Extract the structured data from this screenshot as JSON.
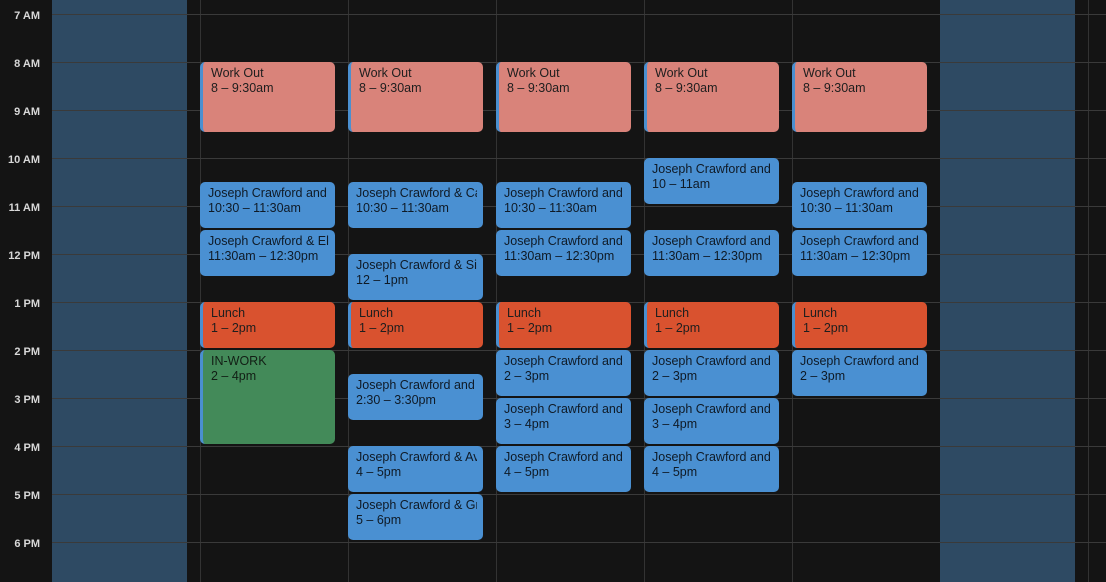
{
  "time_labels": [
    "7 AM",
    "8 AM",
    "9 AM",
    "10 AM",
    "11 AM",
    "12 PM",
    "1 PM",
    "2 PM",
    "3 PM",
    "4 PM",
    "5 PM",
    "6 PM"
  ],
  "colors": {
    "background": "#141414",
    "weekend": "#2e4a63",
    "workout": "#d9837a",
    "meeting": "#4a90d2",
    "lunch": "#d9522f",
    "inwork": "#438a59"
  },
  "events": {
    "mon": [
      {
        "title": "Work Out",
        "time": "8 – 9:30am",
        "kind": "workout"
      },
      {
        "title": "Joseph Crawford and J",
        "time": "10:30 – 11:30am",
        "kind": "meeting"
      },
      {
        "title": "Joseph Crawford & Ele",
        "time": "11:30am – 12:30pm",
        "kind": "meeting"
      },
      {
        "title": "Lunch",
        "time": "1 – 2pm",
        "kind": "lunch"
      },
      {
        "title": "IN-WORK",
        "time": "2 – 4pm",
        "kind": "inwork"
      }
    ],
    "tue": [
      {
        "title": "Work Out",
        "time": "8 – 9:30am",
        "kind": "workout"
      },
      {
        "title": "Joseph Crawford & Ca",
        "time": "10:30 – 11:30am",
        "kind": "meeting"
      },
      {
        "title": "Joseph Crawford & Sie",
        "time": "12 – 1pm",
        "kind": "meeting"
      },
      {
        "title": "Lunch",
        "time": "1 – 2pm",
        "kind": "lunch"
      },
      {
        "title": "Joseph Crawford and",
        "time": "2:30 – 3:30pm",
        "kind": "meeting"
      },
      {
        "title": "Joseph Crawford & Av",
        "time": "4 – 5pm",
        "kind": "meeting"
      },
      {
        "title": "Joseph Crawford & Gr",
        "time": "5 – 6pm",
        "kind": "meeting"
      }
    ],
    "wed": [
      {
        "title": "Work Out",
        "time": "8 – 9:30am",
        "kind": "workout"
      },
      {
        "title": "Joseph Crawford and",
        "time": "10:30 – 11:30am",
        "kind": "meeting"
      },
      {
        "title": "Joseph Crawford and",
        "time": "11:30am – 12:30pm",
        "kind": "meeting"
      },
      {
        "title": "Lunch",
        "time": "1 – 2pm",
        "kind": "lunch"
      },
      {
        "title": "Joseph Crawford and",
        "time": "2 – 3pm",
        "kind": "meeting"
      },
      {
        "title": "Joseph Crawford and",
        "time": "3 – 4pm",
        "kind": "meeting"
      },
      {
        "title": "Joseph Crawford and",
        "time": "4 – 5pm",
        "kind": "meeting"
      }
    ],
    "thu": [
      {
        "title": "Work Out",
        "time": "8 – 9:30am",
        "kind": "workout"
      },
      {
        "title": "Joseph Crawford and",
        "time": "10 – 11am",
        "kind": "meeting"
      },
      {
        "title": "Joseph Crawford and",
        "time": "11:30am – 12:30pm",
        "kind": "meeting"
      },
      {
        "title": "Lunch",
        "time": "1 – 2pm",
        "kind": "lunch"
      },
      {
        "title": "Joseph Crawford and",
        "time": "2 – 3pm",
        "kind": "meeting"
      },
      {
        "title": "Joseph Crawford and",
        "time": "3 – 4pm",
        "kind": "meeting"
      },
      {
        "title": "Joseph Crawford and",
        "time": "4 – 5pm",
        "kind": "meeting"
      }
    ],
    "fri": [
      {
        "title": "Work Out",
        "time": "8 – 9:30am",
        "kind": "workout"
      },
      {
        "title": "Joseph Crawford and",
        "time": "10:30 – 11:30am",
        "kind": "meeting"
      },
      {
        "title": "Joseph Crawford and",
        "time": "11:30am – 12:30pm",
        "kind": "meeting"
      },
      {
        "title": "Lunch",
        "time": "1 – 2pm",
        "kind": "lunch"
      },
      {
        "title": "Joseph Crawford and",
        "time": "2 – 3pm",
        "kind": "meeting"
      }
    ]
  }
}
